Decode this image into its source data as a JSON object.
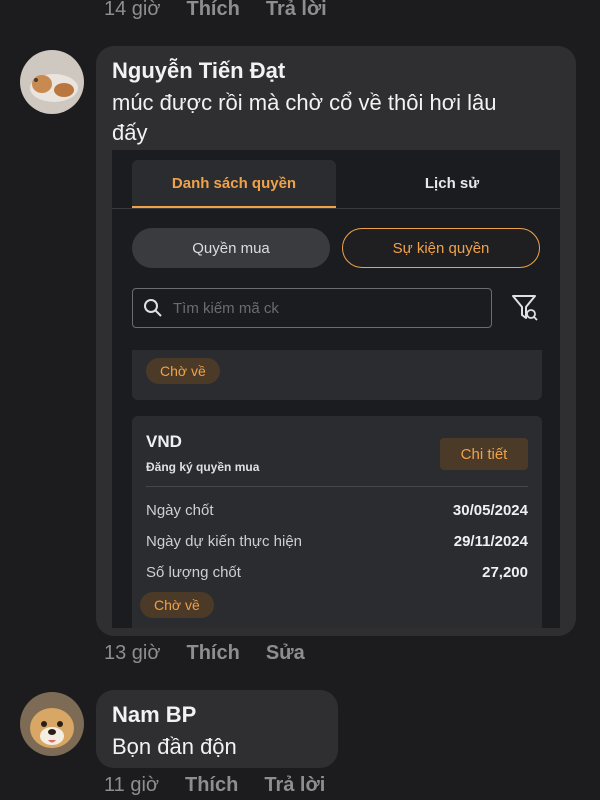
{
  "top_meta": {
    "time": "14 giờ",
    "like": "Thích",
    "reply": "Trả lời"
  },
  "comment1": {
    "author": "Nguyễn Tiến Đạt",
    "text_line1": "múc được rồi mà chờ cổ về thôi hơi lâu",
    "text_line2": "đấy",
    "avatar_icon": "cat-avatar",
    "screenshot": {
      "tabs": [
        {
          "label": "Danh sách quyền",
          "active": true
        },
        {
          "label": "Lịch sử",
          "active": false
        }
      ],
      "pills": [
        {
          "label": "Quyền mua"
        },
        {
          "label": "Sự kiện quyền"
        }
      ],
      "search_placeholder": "Tìm kiếm mã ck",
      "first_card_badge": "Chờ về",
      "card": {
        "symbol": "VND",
        "subtitle": "Đăng ký quyền mua",
        "detail_button": "Chi tiết",
        "rows": [
          {
            "label": "Ngày chốt",
            "value": "30/05/2024"
          },
          {
            "label": "Ngày dự kiến thực hiện",
            "value": "29/11/2024"
          },
          {
            "label": "Số lượng chốt",
            "value": "27,200"
          }
        ],
        "badge": "Chờ về"
      },
      "accent_color": "#f0a24a"
    },
    "meta": {
      "time": "13 giờ",
      "like": "Thích",
      "edit": "Sửa"
    }
  },
  "comment2": {
    "author": "Nam BP",
    "text": "Bọn đần độn",
    "avatar_icon": "dog-avatar",
    "meta": {
      "time": "11 giờ",
      "like": "Thích",
      "reply": "Trả lời"
    }
  }
}
